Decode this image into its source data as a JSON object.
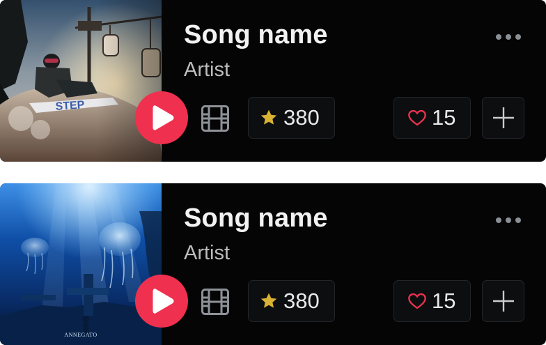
{
  "cards": [
    {
      "artwork": "snowboarder-on-mountain-artwork",
      "title": "Song name",
      "artist": "Artist",
      "rating": "380",
      "likes": "15"
    },
    {
      "artwork": "underwater-jellyfish-artwork",
      "artwork_caption": "ANNEGATO",
      "title": "Song name",
      "artist": "Artist",
      "rating": "380",
      "likes": "15"
    }
  ],
  "icons": {
    "play": "play-icon",
    "video": "film-icon",
    "rating": "star-icon",
    "like": "heart-icon",
    "add": "plus-icon",
    "more": "more-dots-icon"
  },
  "colors": {
    "accent_play": "#f0304f",
    "star": "#d9b233",
    "heart": "#e8334f",
    "card_background": "#050505"
  }
}
